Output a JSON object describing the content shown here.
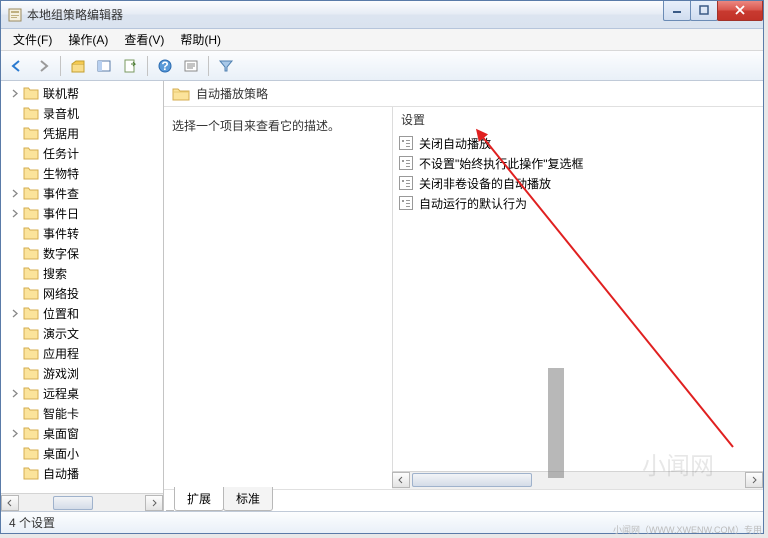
{
  "window": {
    "title": "本地组策略编辑器"
  },
  "menu": {
    "file": "文件(F)",
    "action": "操作(A)",
    "view": "查看(V)",
    "help": "帮助(H)"
  },
  "tree": {
    "items": [
      {
        "label": "联机帮",
        "expandable": true
      },
      {
        "label": "录音机",
        "expandable": false
      },
      {
        "label": "凭据用",
        "expandable": false
      },
      {
        "label": "任务计",
        "expandable": false
      },
      {
        "label": "生物特",
        "expandable": false
      },
      {
        "label": "事件查",
        "expandable": true
      },
      {
        "label": "事件日",
        "expandable": true
      },
      {
        "label": "事件转",
        "expandable": false
      },
      {
        "label": "数字保",
        "expandable": false
      },
      {
        "label": "搜索",
        "expandable": false
      },
      {
        "label": "网络投",
        "expandable": false
      },
      {
        "label": "位置和",
        "expandable": true
      },
      {
        "label": "演示文",
        "expandable": false
      },
      {
        "label": "应用程",
        "expandable": false
      },
      {
        "label": "游戏浏",
        "expandable": false
      },
      {
        "label": "远程桌",
        "expandable": true
      },
      {
        "label": "智能卡",
        "expandable": false
      },
      {
        "label": "桌面窗",
        "expandable": true
      },
      {
        "label": "桌面小",
        "expandable": false
      },
      {
        "label": "自动播",
        "expandable": false
      }
    ]
  },
  "content": {
    "header_title": "自动播放策略",
    "description": "选择一个项目来查看它的描述。",
    "settings_header": "设置",
    "settings": [
      "关闭自动播放",
      "不设置\"始终执行此操作\"复选框",
      "关闭非卷设备的自动播放",
      "自动运行的默认行为"
    ]
  },
  "tabs": {
    "extended": "扩展",
    "standard": "标准"
  },
  "status": {
    "text": "4 个设置"
  }
}
